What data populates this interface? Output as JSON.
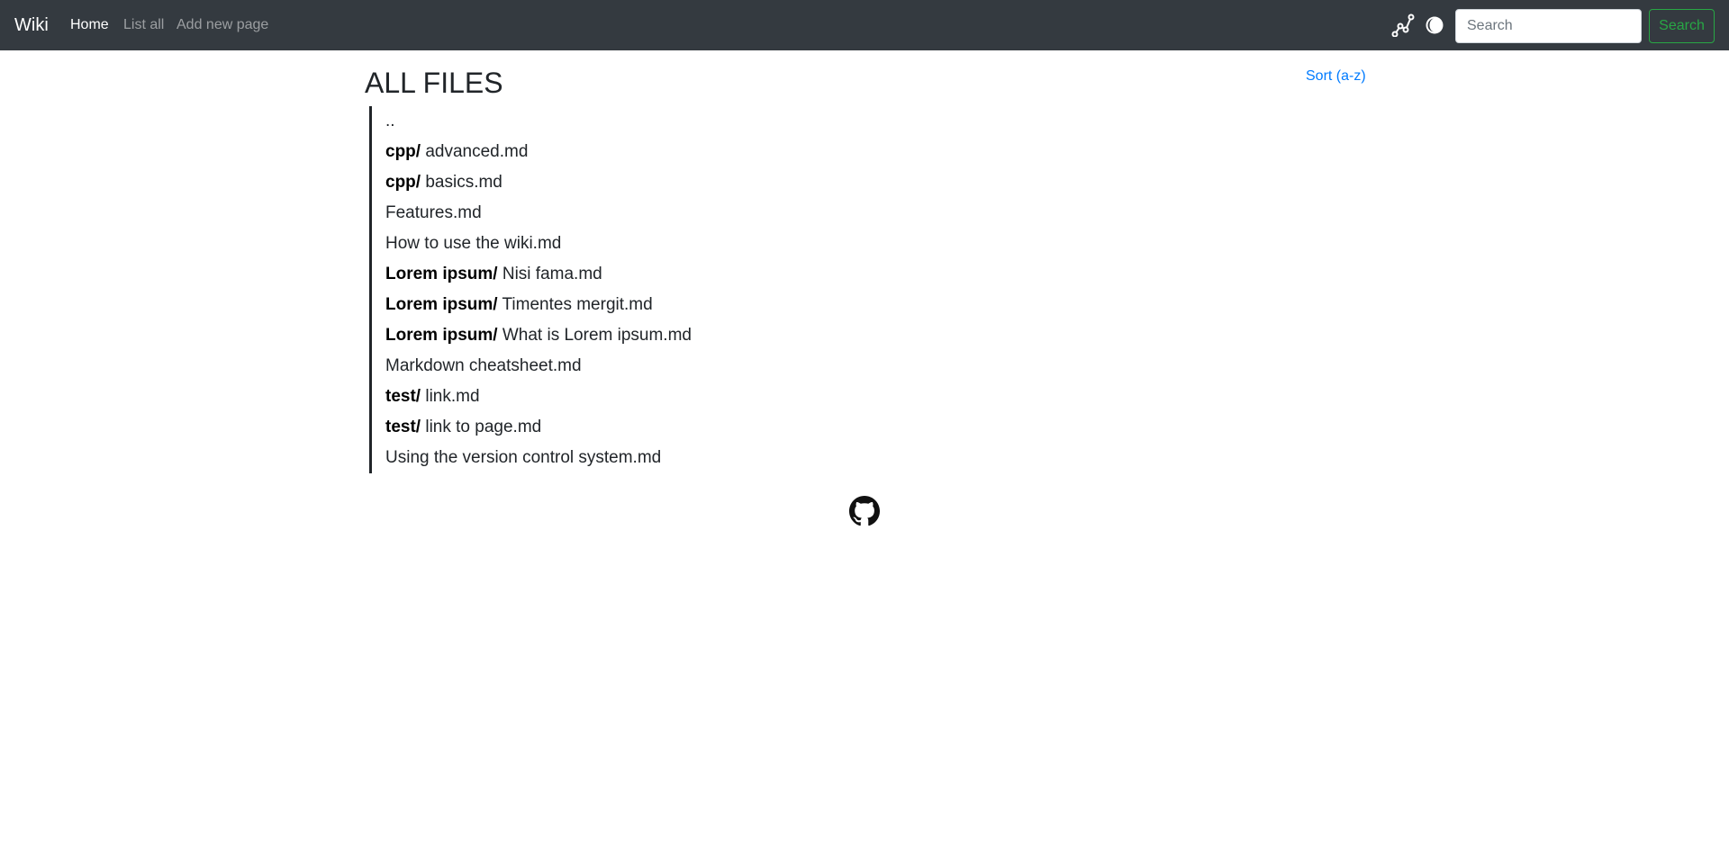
{
  "navbar": {
    "brand": "Wiki",
    "links": [
      {
        "label": "Home",
        "active": true
      },
      {
        "label": "List all",
        "active": false
      },
      {
        "label": "Add new page",
        "active": false
      }
    ],
    "icons": [
      "graph-icon",
      "theme-toggle-icon"
    ],
    "search": {
      "placeholder": "Search",
      "value": "",
      "button_label": "Search"
    },
    "background_color": "#343a40",
    "accent_color": "#28a745"
  },
  "main": {
    "title": "ALL FILES",
    "sort_label": "Sort (a-z)",
    "files": [
      {
        "folder": "",
        "name": ".."
      },
      {
        "folder": "cpp/",
        "name": "advanced.md"
      },
      {
        "folder": "cpp/",
        "name": "basics.md"
      },
      {
        "folder": "",
        "name": "Features.md"
      },
      {
        "folder": "",
        "name": "How to use the wiki.md"
      },
      {
        "folder": "Lorem ipsum/",
        "name": "Nisi fama.md"
      },
      {
        "folder": "Lorem ipsum/",
        "name": "Timentes mergit.md"
      },
      {
        "folder": "Lorem ipsum/",
        "name": "What is Lorem ipsum.md"
      },
      {
        "folder": "",
        "name": "Markdown cheatsheet.md"
      },
      {
        "folder": "test/",
        "name": "link.md"
      },
      {
        "folder": "test/",
        "name": "link to page.md"
      },
      {
        "folder": "",
        "name": "Using the version control system.md"
      }
    ],
    "link_color": "#007bff"
  },
  "footer": {
    "icon": "github-icon"
  }
}
